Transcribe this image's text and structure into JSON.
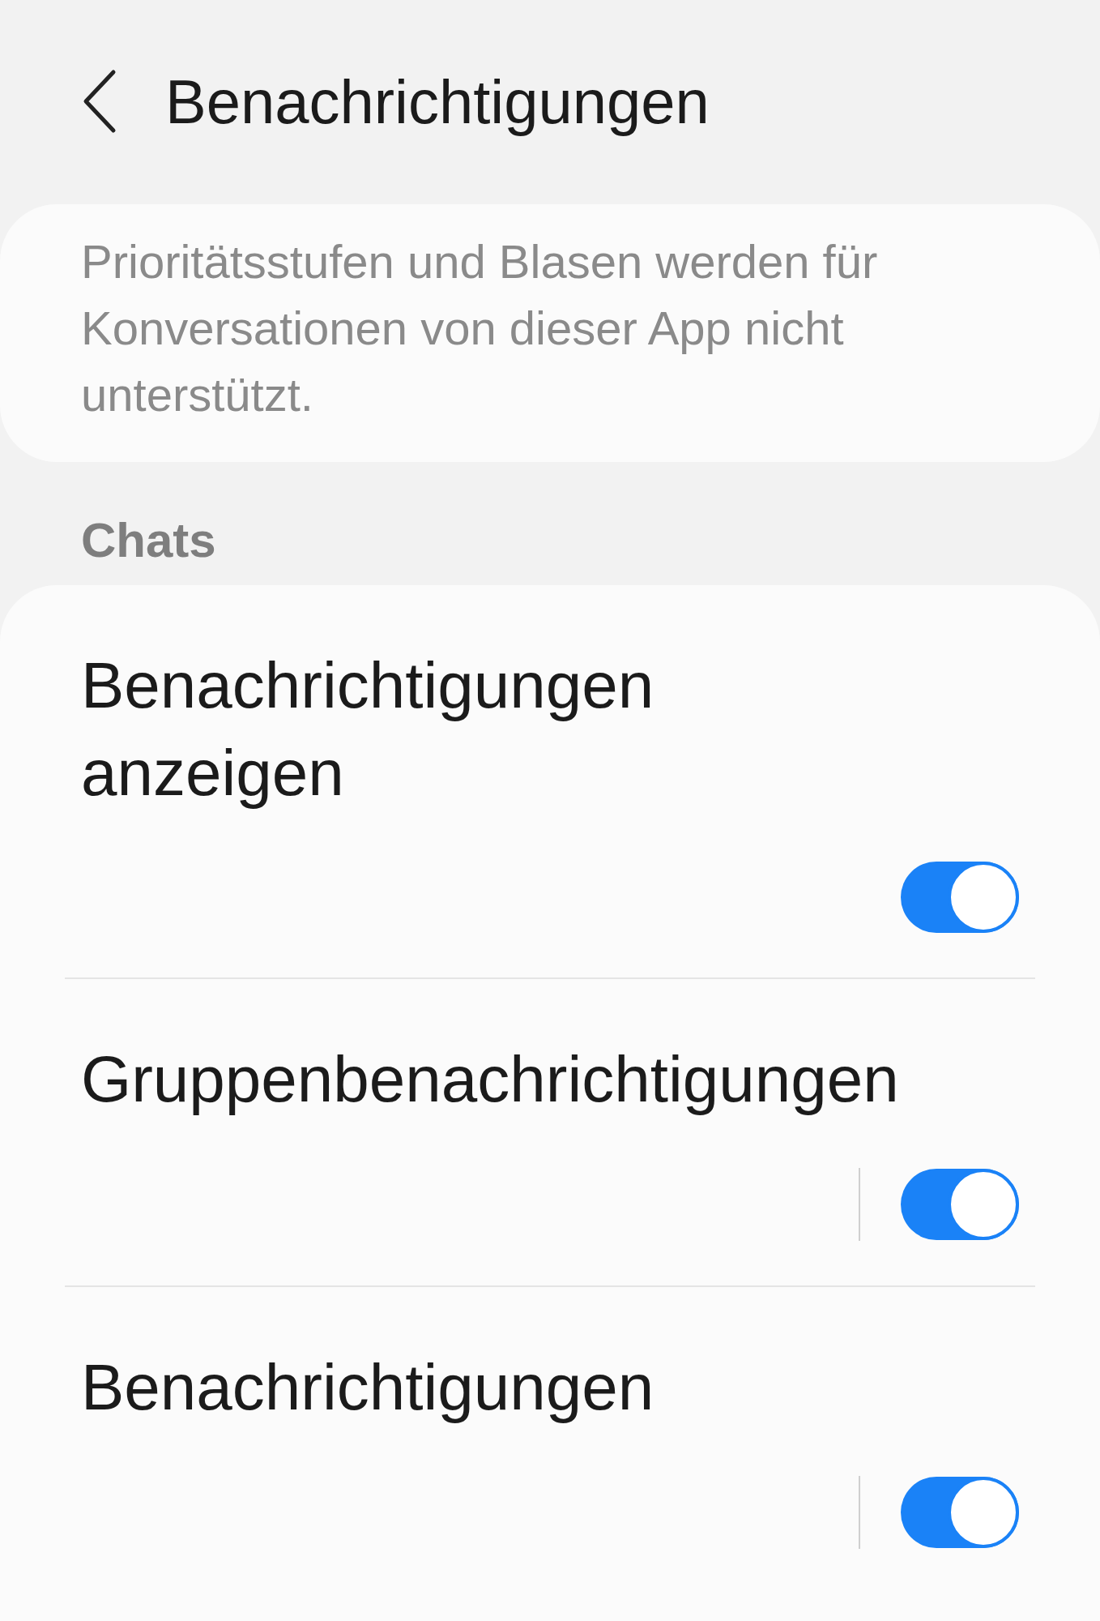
{
  "header": {
    "title": "Benachrichtigungen"
  },
  "info": {
    "text": "Prioritätsstufen und Blasen werden für Konversationen von dieser App nicht unterstützt."
  },
  "section": {
    "label": "Chats"
  },
  "rows": [
    {
      "label": "Benachrichtigungen anzeigen",
      "kind": "plain",
      "on": true
    },
    {
      "label": "Gruppenbenachrichtigungen",
      "kind": "split",
      "on": true
    },
    {
      "label": "Benachrichtigungen",
      "kind": "split",
      "on": true
    }
  ]
}
